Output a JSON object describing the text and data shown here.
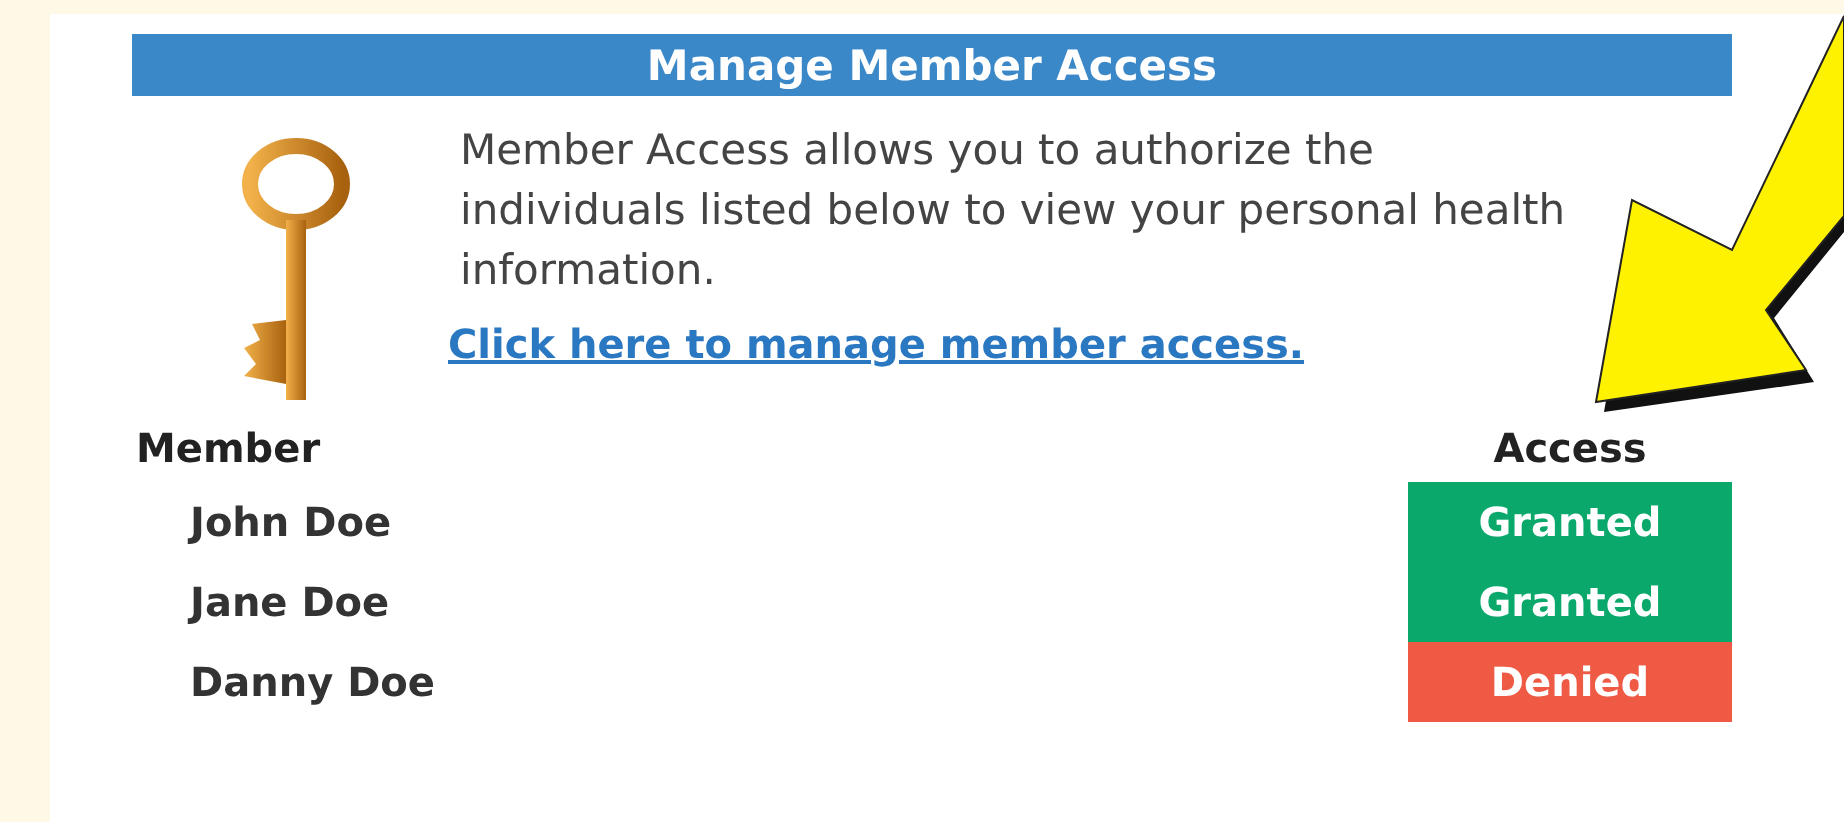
{
  "header": {
    "title": "Manage Member Access"
  },
  "intro": {
    "text": "Member Access allows you to authorize the individuals listed below to view your personal health information.",
    "link": "Click here to manage member access."
  },
  "table": {
    "columns": [
      "Member",
      "Access"
    ],
    "rows": [
      {
        "member": "John Doe",
        "access": "Granted",
        "color": "#0aa96b"
      },
      {
        "member": "Jane Doe",
        "access": "Granted",
        "color": "#0aa96b"
      },
      {
        "member": "Danny Doe",
        "access": "Denied",
        "color": "#ee5a44"
      }
    ]
  }
}
